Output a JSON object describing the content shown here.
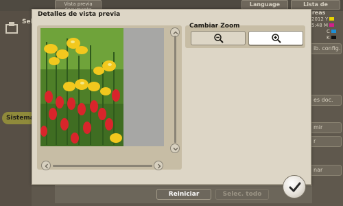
{
  "background": {
    "tabs": {
      "preview": "Vista previa documento",
      "language": "Language",
      "job_queue": "Lista de tareas"
    },
    "left_label": "Sel",
    "system_label": "Sistema",
    "status": {
      "year": "2012",
      "time": "5:48",
      "colors": [
        {
          "letter": "Y",
          "color": "#e8d400"
        },
        {
          "letter": "M",
          "color": "#d0208a"
        },
        {
          "letter": "C",
          "color": "#1e8fd6"
        },
        {
          "letter": "K",
          "color": "#111111"
        }
      ]
    },
    "right_buttons": [
      "ib. config.",
      "es doc.",
      "mir",
      "r",
      "nar"
    ],
    "bottom_buttons": {
      "reset": "Reiniciar",
      "select_all": "Selec. todo"
    }
  },
  "dialog": {
    "title": "Detalles de vista previa",
    "zoom": {
      "label": "Cambiar Zoom",
      "zoom_out_icon": "zoom-out-icon",
      "zoom_in_icon": "zoom-in-icon",
      "selected": "zoom-in"
    },
    "preview_image": "tulips-and-fritillaria-photo"
  },
  "ok_icon": "checkmark-icon",
  "colors": {
    "dialog_bg": "#ddd6c6",
    "panel_bg": "#c7bda5",
    "dim_bg": "#5f584d"
  }
}
